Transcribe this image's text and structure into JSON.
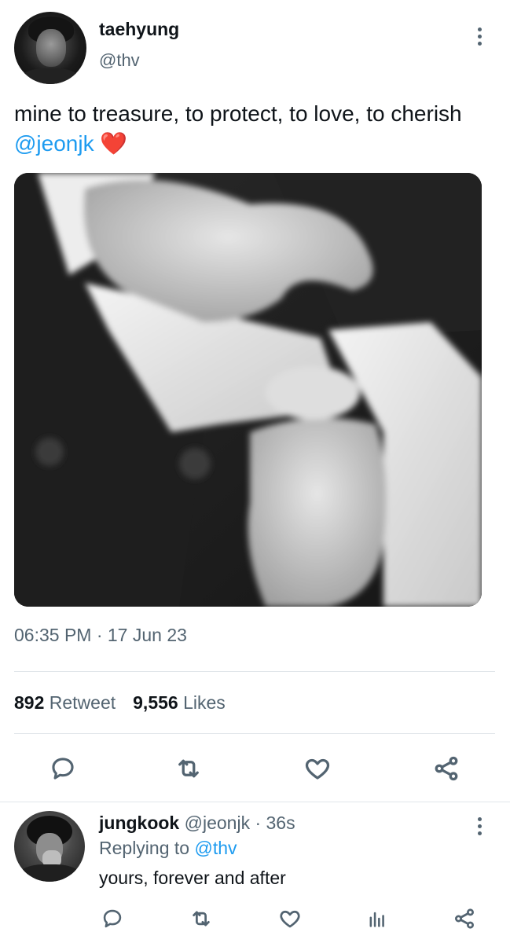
{
  "tweet": {
    "author": {
      "display_name": "taehyung",
      "handle": "@thv"
    },
    "text_main": "mine to treasure, to protect, to love, to cherish ",
    "mention": "@jeonjk",
    "emoji": "❤️",
    "timestamp": "06:35 PM · 17 Jun 23",
    "stats": {
      "retweets": "892",
      "retweets_label": "Retweet",
      "likes": "9,556",
      "likes_label": "Likes"
    },
    "actions": [
      "reply-icon",
      "retweet-icon",
      "heart-icon",
      "share-icon"
    ]
  },
  "reply": {
    "author": {
      "display_name": "jungkook",
      "handle": "@jeonjk",
      "time": " · 36s"
    },
    "replying_prefix": "Replying to ",
    "replying_to": "@thv",
    "text": "yours, forever and after",
    "actions": [
      "reply-icon",
      "retweet-icon",
      "heart-icon",
      "analytics-icon",
      "share-icon"
    ]
  },
  "colors": {
    "text": "#0f1419",
    "secondary": "#536471",
    "link": "#1d9bf0",
    "divider": "#e1e6ea"
  }
}
